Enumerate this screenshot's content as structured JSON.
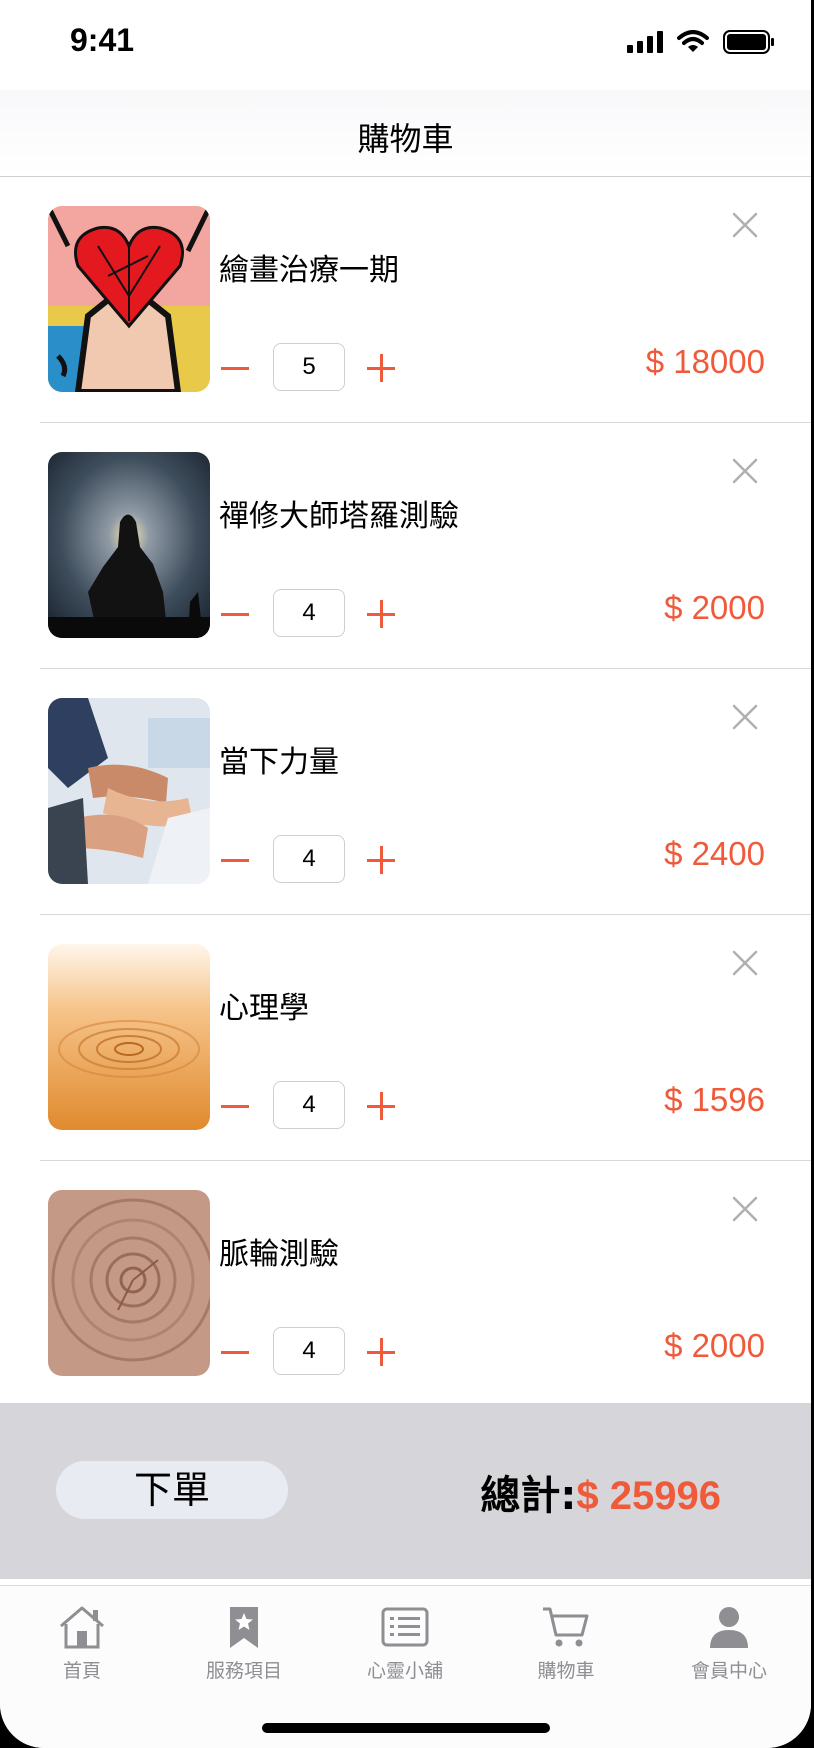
{
  "status_bar": {
    "time": "9:41"
  },
  "nav": {
    "title": "購物車"
  },
  "cart": {
    "items": [
      {
        "name": "繪畫治療一期",
        "qty": "5",
        "price": "$ 18000"
      },
      {
        "name": "禪修大師塔羅測驗",
        "qty": "4",
        "price": "$ 2000"
      },
      {
        "name": "當下力量",
        "qty": "4",
        "price": "$ 2400"
      },
      {
        "name": "心理學",
        "qty": "4",
        "price": "$ 1596"
      },
      {
        "name": "脈輪測驗",
        "qty": "4",
        "price": "$ 2000"
      }
    ]
  },
  "summary": {
    "order_label": "下單",
    "total_label": "總計:",
    "total_value": "$ 25996"
  },
  "tabs": [
    {
      "label": "首頁",
      "icon": "home-icon"
    },
    {
      "label": "服務項目",
      "icon": "bookmark-star-icon"
    },
    {
      "label": "心靈小舖",
      "icon": "list-icon"
    },
    {
      "label": "購物車",
      "icon": "cart-icon"
    },
    {
      "label": "會員中心",
      "icon": "person-icon"
    }
  ],
  "colors": {
    "accent": "#ef5a3a",
    "summary_bg": "#d6d6da",
    "tab_gray": "#8e8e93"
  }
}
